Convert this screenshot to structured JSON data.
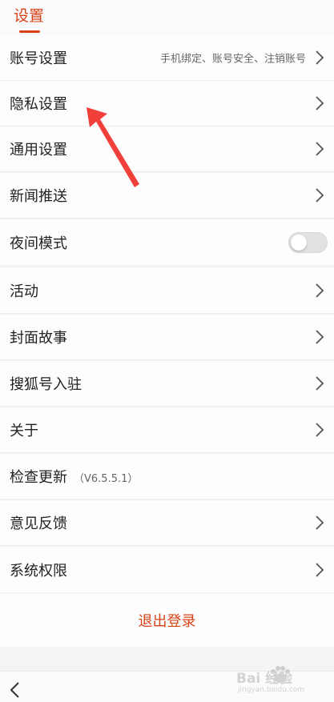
{
  "header": {
    "title": "设置"
  },
  "rows": [
    {
      "label": "账号设置",
      "sub": "手机绑定、账号安全、注销账号"
    },
    {
      "label": "隐私设置"
    },
    {
      "label": "通用设置"
    },
    {
      "label": "新闻推送"
    },
    {
      "label": "夜间模式",
      "toggle": "off"
    },
    {
      "label": "活动"
    },
    {
      "label": "封面故事"
    },
    {
      "label": "搜狐号入驻"
    },
    {
      "label": "关于"
    },
    {
      "label": "检查更新",
      "version": "（V6.5.5.1）"
    },
    {
      "label": "意见反馈"
    },
    {
      "label": "系统权限"
    }
  ],
  "logout": {
    "label": "退出登录"
  },
  "watermark": {
    "text": "Bai  经验",
    "url": "jingyan.baidu.com"
  },
  "colors": {
    "accent": "#d84315",
    "annotation_arrow": "#f1403a"
  },
  "icons": {
    "row_chevron": "chevron-right-icon",
    "back": "chevron-left-icon"
  }
}
